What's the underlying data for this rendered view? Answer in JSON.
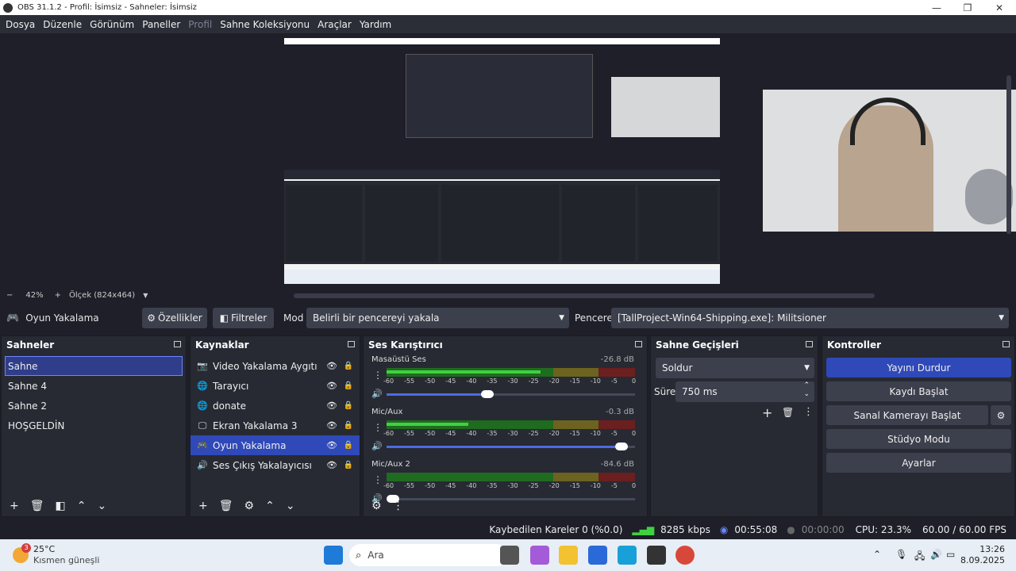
{
  "window": {
    "title": "OBS 31.1.2 - Profil: İsimsiz - Sahneler: İsimsiz",
    "minimize": "—",
    "maximize": "❐",
    "close": "✕"
  },
  "menu": [
    {
      "label": "Dosya",
      "enabled": true
    },
    {
      "label": "Düzenle",
      "enabled": true
    },
    {
      "label": "Görünüm",
      "enabled": true
    },
    {
      "label": "Paneller",
      "enabled": true
    },
    {
      "label": "Profil",
      "enabled": false
    },
    {
      "label": "Sahne Koleksiyonu",
      "enabled": true
    },
    {
      "label": "Araçlar",
      "enabled": true
    },
    {
      "label": "Yardım",
      "enabled": true
    }
  ],
  "preview": {
    "zoom_minus": "−",
    "zoom_value": "42%",
    "zoom_plus": "+",
    "scale_label": "Ölçek (824x464)"
  },
  "source_toolbar": {
    "source_name": "Oyun Yakalama",
    "properties_label": "Özellikler",
    "filters_label": "Filtreler",
    "mode_label": "Mod",
    "mode_value": "Belirli bir pencereyi yakala",
    "window_label": "Pencere",
    "window_value": "[TallProject-Win64-Shipping.exe]: Militsioner"
  },
  "scenes": {
    "title": "Sahneler",
    "items": [
      "Sahne",
      "Sahne 4",
      "Sahne 2",
      "HOŞGELDİN"
    ]
  },
  "sources": {
    "title": "Kaynaklar",
    "items": [
      {
        "label": "Video Yakalama Aygıtı",
        "icon": "camera-icon"
      },
      {
        "label": "Tarayıcı",
        "icon": "globe-icon"
      },
      {
        "label": "donate",
        "icon": "globe-icon"
      },
      {
        "label": "Ekran Yakalama 3",
        "icon": "monitor-icon"
      },
      {
        "label": "Oyun Yakalama",
        "icon": "gamepad-icon"
      },
      {
        "label": "Ses Çıkış Yakalayıcısı",
        "icon": "speaker-icon"
      }
    ]
  },
  "mixer": {
    "title": "Ses Karıştırıcı",
    "ticks": [
      "-60",
      "-55",
      "-50",
      "-45",
      "-40",
      "-35",
      "-30",
      "-25",
      "-20",
      "-15",
      "-10",
      "-5",
      "0"
    ],
    "channels": [
      {
        "name": "Masaüstü Ses",
        "db": "-26.8 dB",
        "level": 0.62,
        "volume": 0.43
      },
      {
        "name": "Mic/Aux",
        "db": "-0.3 dB",
        "level": 0.33,
        "volume": 0.97
      },
      {
        "name": "Mic/Aux 2",
        "db": "-84.6 dB",
        "level": 0.0,
        "volume": 0.0
      }
    ]
  },
  "transitions": {
    "title": "Sahne Geçişleri",
    "selected": "Soldur",
    "duration_label": "Süre",
    "duration_value": "750 ms"
  },
  "controls": {
    "title": "Kontroller",
    "buttons": [
      "Yayını Durdur",
      "Kaydı Başlat",
      "Sanal Kamerayı Başlat",
      "Stüdyo Modu",
      "Ayarlar"
    ]
  },
  "status": {
    "dropped": "Kaybedilen Kareler 0 (%0.0)",
    "bitrate": "8285 kbps",
    "stream_time": "00:55:08",
    "rec_time": "00:00:00",
    "cpu": "CPU: 23.3%",
    "fps": "60.00 / 60.00 FPS"
  },
  "taskbar": {
    "weather_temp": "25°C",
    "weather_desc": "Kısmen güneşli",
    "weather_badge": "3",
    "search": "Ara",
    "time": "13:26",
    "date": "8.09.2025"
  },
  "colors": {
    "accent": "#2f49b9",
    "meter_green": "#3fd13f",
    "meter_yellow": "#d1c23f",
    "meter_red": "#d13f3f"
  }
}
